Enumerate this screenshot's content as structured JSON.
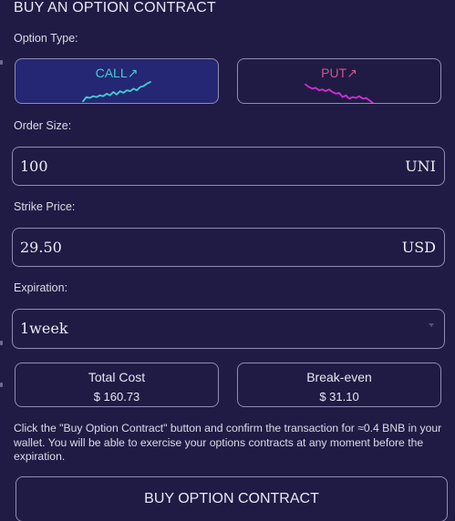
{
  "header": {
    "title": "BUY AN OPTION CONTRACT"
  },
  "option_type": {
    "label": "Option Type:",
    "call_label": "CALL↗",
    "put_label": "PUT↗",
    "selected": "CALL",
    "call_color": "#41cdd1",
    "put_color": "#d94f96"
  },
  "order_size": {
    "label": "Order Size:",
    "value": "100",
    "unit": "UNI"
  },
  "strike_price": {
    "label": "Strike Price:",
    "value": "29.50",
    "unit": "USD"
  },
  "expiration": {
    "label": "Expiration:",
    "value": "1week"
  },
  "total_cost": {
    "label": "Total Cost",
    "value": "$ 160.73"
  },
  "break_even": {
    "label": "Break-even",
    "value": "$ 31.10"
  },
  "note": "Click the \"Buy Option Contract\" button and confirm the transaction for ≈0.4 BNB in your wallet. You will be able to exercise your options contracts at any moment before the expiration.",
  "buy_button": {
    "label": "BUY OPTION CONTRACT"
  },
  "colors": {
    "background": "#1f1b44",
    "selected_bg": "#252674",
    "border": "#8f8cb6"
  }
}
